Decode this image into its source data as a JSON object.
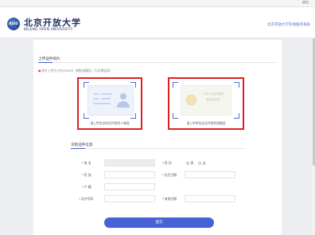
{
  "topbar": {
    "logout_label": "退出"
  },
  "header": {
    "logo_mark": "BJOU",
    "logo_cn": "北京开放大学",
    "logo_en": "BEIJING OPEN UNIVERSITY",
    "site_title": "北京开放大学在线服务系统"
  },
  "upload_section": {
    "title": "上传证件照片",
    "hint": "照片上传大小在2M以内（横拍或翻拍，均可横竖屏）",
    "front_caption": "请上传包含的证件照的人像面",
    "back_caption": "请上传带包含证件照的国徽面",
    "back_card_text_1": "中华人民共和国",
    "back_card_text_2": "居民身份证"
  },
  "info_section": {
    "title": "识别证件信息",
    "labels": {
      "name": "姓  名",
      "gender": "性  别",
      "ethnicity": "民  族",
      "birth_date": "出生日期",
      "household": "户  籍",
      "id_number": "证件号码",
      "validity": "有效日期"
    },
    "gender_options": [
      "男",
      "女"
    ],
    "required_mark": "*"
  },
  "actions": {
    "submit_label": "提交"
  },
  "colors": {
    "accent": "#4662d5",
    "highlight_border": "#e02020",
    "link": "#4a73c7"
  }
}
